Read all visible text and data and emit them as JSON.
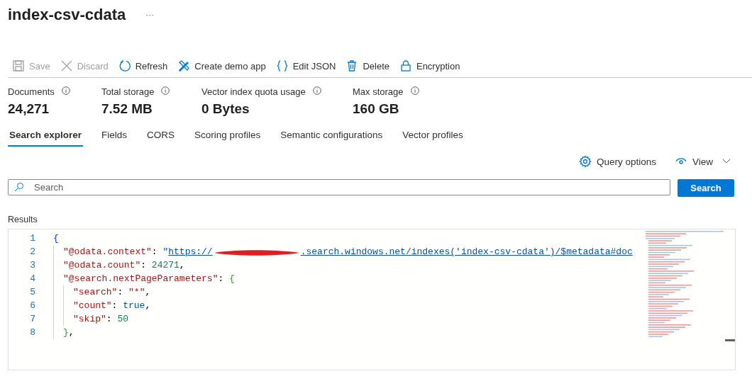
{
  "title": "index-csv-cdata",
  "more": "···",
  "toolbar": [
    {
      "kind": "save",
      "label": "Save",
      "disabled": true
    },
    {
      "kind": "discard",
      "label": "Discard",
      "disabled": true
    },
    {
      "kind": "refresh",
      "label": "Refresh",
      "disabled": false
    },
    {
      "kind": "demo",
      "label": "Create demo app",
      "disabled": false
    },
    {
      "kind": "json",
      "label": "Edit JSON",
      "disabled": false
    },
    {
      "kind": "delete",
      "label": "Delete",
      "disabled": false
    },
    {
      "kind": "lock",
      "label": "Encryption",
      "disabled": false
    }
  ],
  "stats": [
    {
      "label": "Documents",
      "value": "24,271"
    },
    {
      "label": "Total storage",
      "value": "7.52 MB"
    },
    {
      "label": "Vector index quota usage",
      "value": "0 Bytes"
    },
    {
      "label": "Max storage",
      "value": "160 GB"
    }
  ],
  "tabs": [
    {
      "label": "Search explorer",
      "selected": true
    },
    {
      "label": "Fields",
      "selected": false
    },
    {
      "label": "CORS",
      "selected": false
    },
    {
      "label": "Scoring profiles",
      "selected": false
    },
    {
      "label": "Semantic configurations",
      "selected": false
    },
    {
      "label": "Vector profiles",
      "selected": false
    }
  ],
  "actions": [
    {
      "kind": "gear",
      "label": "Query options"
    },
    {
      "kind": "view",
      "label": "View"
    }
  ],
  "search": {
    "placeholder": "Search",
    "button": "Search"
  },
  "results": {
    "label": "Results",
    "lines": [
      {
        "number": "1",
        "tokens": [
          {
            "kind": "brace",
            "text": "{"
          }
        ],
        "children": [
          {
            "number": "2",
            "tokens": [
              {
                "kind": "key",
                "text": "\"@odata.context\""
              },
              {
                "kind": "punct",
                "text": ": "
              },
              {
                "kind": "string",
                "text": "\""
              },
              {
                "kind": "link",
                "text": "https://"
              },
              {
                "kind": "redaction"
              },
              {
                "kind": "link",
                "text": ".search.windows.net/indexes('index-csv-cdata')/$metadata#doc"
              }
            ]
          },
          {
            "number": "3",
            "tokens": [
              {
                "kind": "key",
                "text": "\"@odata.count\""
              },
              {
                "kind": "punct",
                "text": ": "
              },
              {
                "kind": "number",
                "text": "24271"
              },
              {
                "kind": "punct",
                "text": ","
              }
            ]
          },
          {
            "number": "4",
            "tokens": [
              {
                "kind": "key",
                "text": "\"@search.nextPageParameters\""
              },
              {
                "kind": "punct",
                "text": ": "
              },
              {
                "kind": "brace2",
                "text": "{"
              }
            ],
            "children": [
              {
                "number": "5",
                "tokens": [
                  {
                    "kind": "key",
                    "text": "\"search\""
                  },
                  {
                    "kind": "punct",
                    "text": ": "
                  },
                  {
                    "kind": "key",
                    "text": "\"*\""
                  },
                  {
                    "kind": "punct",
                    "text": ","
                  }
                ]
              },
              {
                "number": "6",
                "tokens": [
                  {
                    "kind": "key",
                    "text": "\"count\""
                  },
                  {
                    "kind": "punct",
                    "text": ": "
                  },
                  {
                    "kind": "keyword",
                    "text": "true"
                  },
                  {
                    "kind": "punct",
                    "text": ","
                  }
                ]
              },
              {
                "number": "7",
                "tokens": [
                  {
                    "kind": "key",
                    "text": "\"skip\""
                  },
                  {
                    "kind": "punct",
                    "text": ": "
                  },
                  {
                    "kind": "number",
                    "text": "50"
                  }
                ]
              }
            ]
          },
          {
            "number": "8",
            "tokens": [
              {
                "kind": "brace2",
                "text": "}"
              },
              {
                "kind": "punct",
                "text": ","
              }
            ]
          }
        ]
      }
    ]
  }
}
